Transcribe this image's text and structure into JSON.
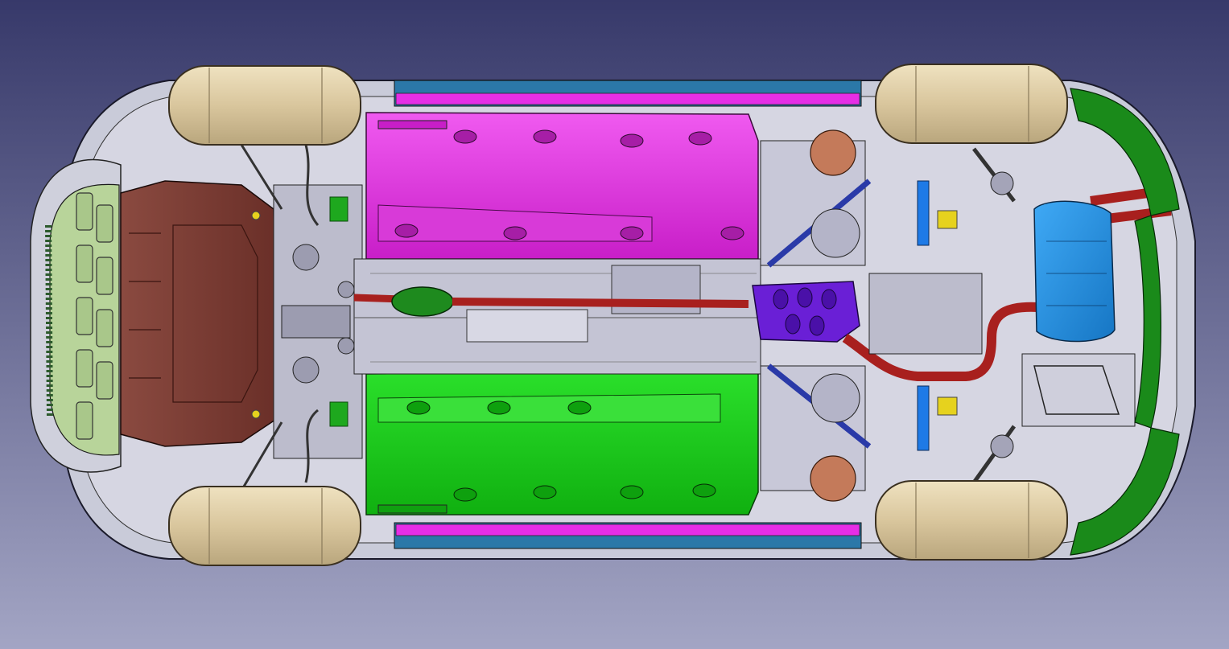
{
  "viewport": {
    "background_top": "#37396a",
    "background_bottom": "#a3a5c4"
  },
  "model": {
    "colors": {
      "tire": "#d9c69d",
      "tire_edge": "#3a3020",
      "body_shell": "#c9cbd9",
      "chassis_grey": "#d6d6e2",
      "underbody_dark": "#9c9cb0",
      "front_grille": "#b8d49a",
      "engine_undertray": "#7a3b32",
      "left_floor_panel": "#e62ee6",
      "right_floor_panel": "#1ed11e",
      "side_sill_top": "#e62ee6",
      "side_sill_bottom": "#e62ee6",
      "sill_blue": "#2b78a8",
      "exhaust_pipe": "#a8201e",
      "catalytic_converter": "#1e8a1e",
      "center_muffler": "#6a1fd6",
      "rear_muffler": "#1e8ee6",
      "rear_bumper": "#1a8a1a",
      "brake_disc": "#c47a5a",
      "heat_shield": "#c8c8d8",
      "yellow_part": "#e6d21e"
    }
  }
}
